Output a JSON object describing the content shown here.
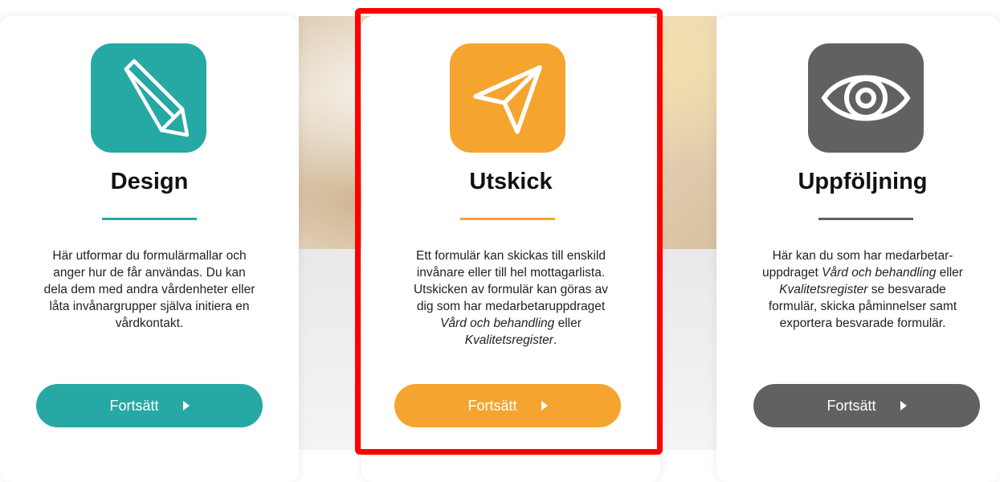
{
  "colors": {
    "teal": "#26a9a4",
    "orange": "#f5a52f",
    "gray": "#616161",
    "highlight": "#ff0000"
  },
  "cards": [
    {
      "title": "Design",
      "icon": "pencil-icon",
      "lines": [
        "Här utformar du formulärmallar och",
        "anger hur de får användas. Du kan",
        "dela dem med andra vårdenheter eller",
        "låta invånargrupper själva initiera en",
        "vårdkontakt."
      ],
      "button": "Fortsätt"
    },
    {
      "title": "Utskick",
      "icon": "paper-plane-icon",
      "lines": [
        "Ett formulär kan skickas till enskild",
        "invånare eller till hel mottagarlista.",
        "Utskicken av formulär kan göras av",
        "dig som har medarbetaruppdraget"
      ],
      "italic1": "Vård och behandling",
      "text_after1": " eller",
      "italic2": "Kvalitetsregister",
      "text_after2": ".",
      "button": "Fortsätt"
    },
    {
      "title": "Uppföljning",
      "icon": "eye-icon",
      "line1": "Här kan du som har medarbetar-",
      "line2_prefix": "uppdraget ",
      "italic1": "Vård och behandling",
      "line2_suffix": " eller",
      "italic2": "Kvalitetsregister",
      "line3_suffix": " se besvarade",
      "line4": "formulär, skicka påminnelser samt",
      "line5": "exportera besvarade formulär.",
      "button": "Fortsätt"
    }
  ]
}
